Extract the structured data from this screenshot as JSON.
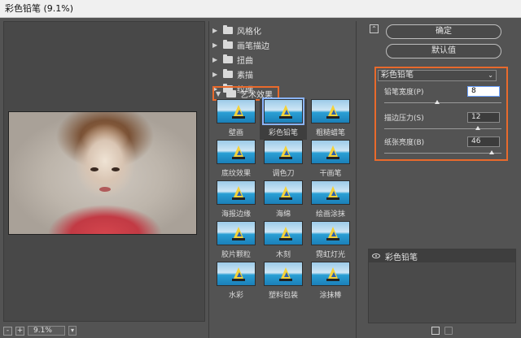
{
  "window": {
    "title": "彩色铅笔 (9.1%)"
  },
  "status": {
    "btn_minus": "-",
    "btn_plus": "+",
    "zoom": "9.1%",
    "caret": "▾"
  },
  "gallery": {
    "categories": [
      {
        "label": "风格化",
        "open": false
      },
      {
        "label": "画笔描边",
        "open": false
      },
      {
        "label": "扭曲",
        "open": false
      },
      {
        "label": "素描",
        "open": false
      },
      {
        "label": "纹理",
        "open": false
      },
      {
        "label": "艺术效果",
        "open": true
      }
    ],
    "filters": [
      {
        "label": "壁画"
      },
      {
        "label": "彩色铅笔",
        "selected": true
      },
      {
        "label": "粗糙蜡笔"
      },
      {
        "label": "底纹效果"
      },
      {
        "label": "调色刀"
      },
      {
        "label": "干画笔"
      },
      {
        "label": "海报边缘"
      },
      {
        "label": "海绵"
      },
      {
        "label": "绘画涂抹"
      },
      {
        "label": "胶片颗粒"
      },
      {
        "label": "木刻"
      },
      {
        "label": "霓虹灯光"
      },
      {
        "label": "水彩"
      },
      {
        "label": "塑料包装"
      },
      {
        "label": "涂抹棒"
      }
    ]
  },
  "right": {
    "collapse": "⌃",
    "ok_label": "确定",
    "default_label": "默认值",
    "filter_select": "彩色铅笔",
    "select_chevron": "⌄",
    "params": [
      {
        "label": "铅笔宽度(P)",
        "value": "8",
        "slider": 0.45
      },
      {
        "label": "描边压力(S)",
        "value": "12",
        "slider": 0.8
      },
      {
        "label": "纸张亮度(B)",
        "value": "46",
        "slider": 0.92
      }
    ],
    "layer_name": "彩色铅笔"
  }
}
